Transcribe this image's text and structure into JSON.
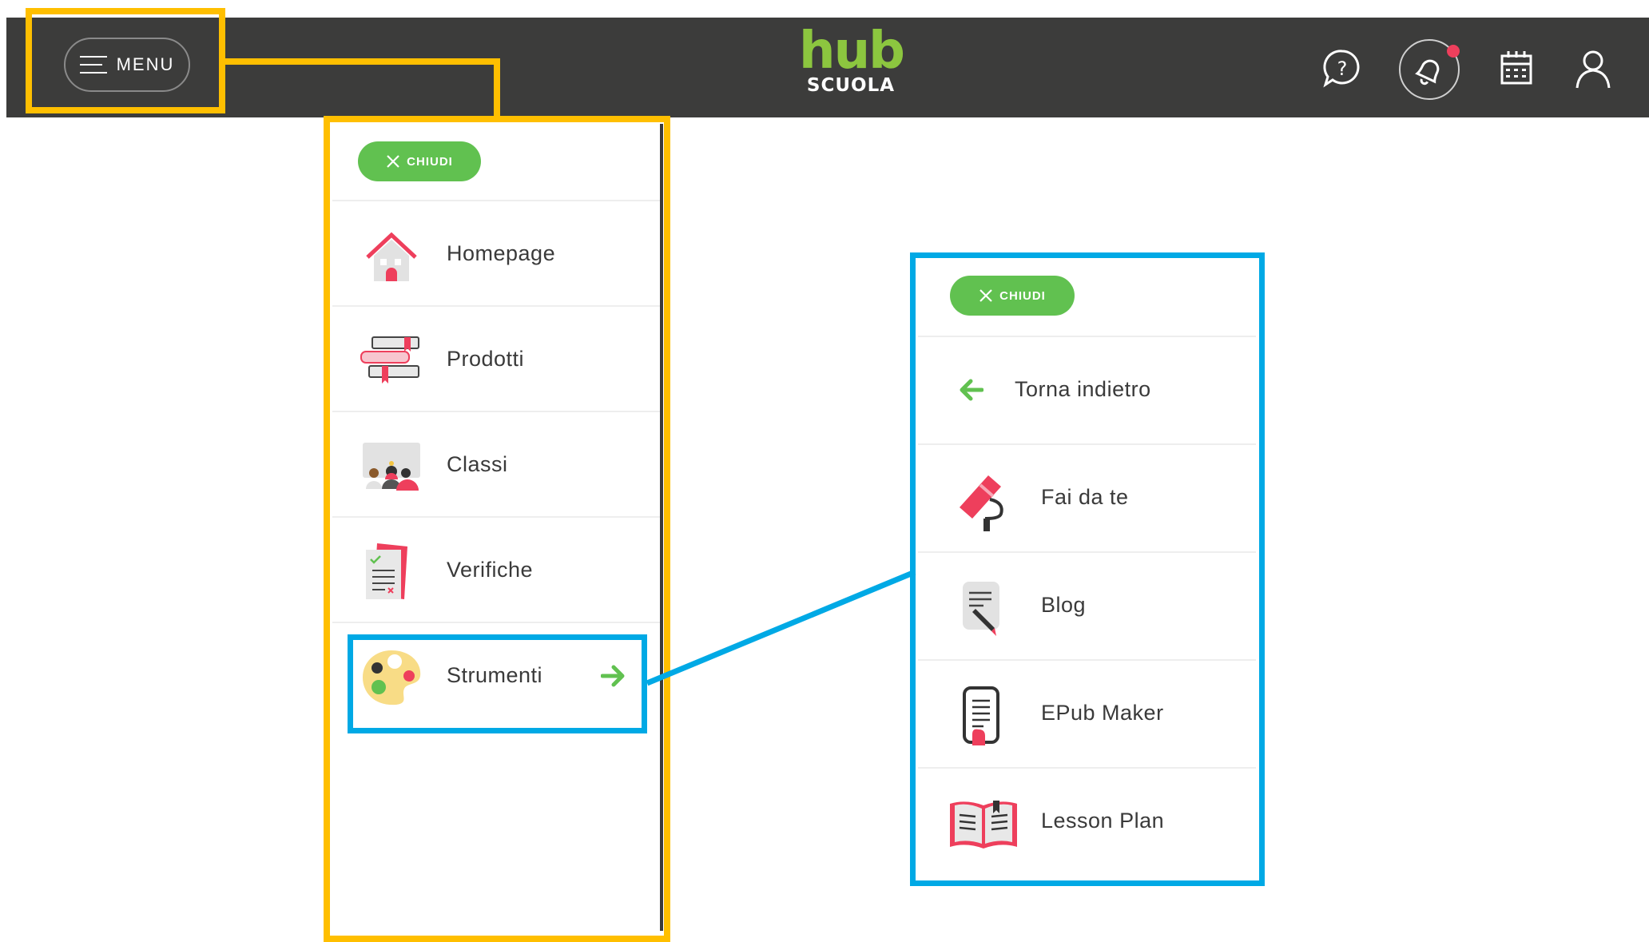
{
  "header": {
    "menu_label": "MENU",
    "logo_top": "hub",
    "logo_bottom": "SCUOLA",
    "icons": [
      "help-icon",
      "bell-icon",
      "calendar-icon",
      "user-icon"
    ]
  },
  "left_menu": {
    "close_label": "CHIUDI",
    "items": [
      {
        "label": "Homepage",
        "icon": "house-icon"
      },
      {
        "label": "Prodotti",
        "icon": "books-icon"
      },
      {
        "label": "Classi",
        "icon": "class-icon"
      },
      {
        "label": "Verifiche",
        "icon": "test-icon"
      },
      {
        "label": "Strumenti",
        "icon": "palette-icon"
      }
    ]
  },
  "right_menu": {
    "close_label": "CHIUDI",
    "back_label": "Torna indietro",
    "items": [
      {
        "label": "Fai da te",
        "icon": "paint-roller-icon"
      },
      {
        "label": "Blog",
        "icon": "blog-icon"
      },
      {
        "label": "EPub Maker",
        "icon": "epub-icon"
      },
      {
        "label": "Lesson Plan",
        "icon": "book-icon"
      }
    ]
  },
  "colors": {
    "topbar": "#3c3c3b",
    "accent_green": "#61c150",
    "highlight_yellow": "#ffbf00",
    "highlight_blue": "#00a9e5",
    "pink": "#ee3f5c"
  }
}
